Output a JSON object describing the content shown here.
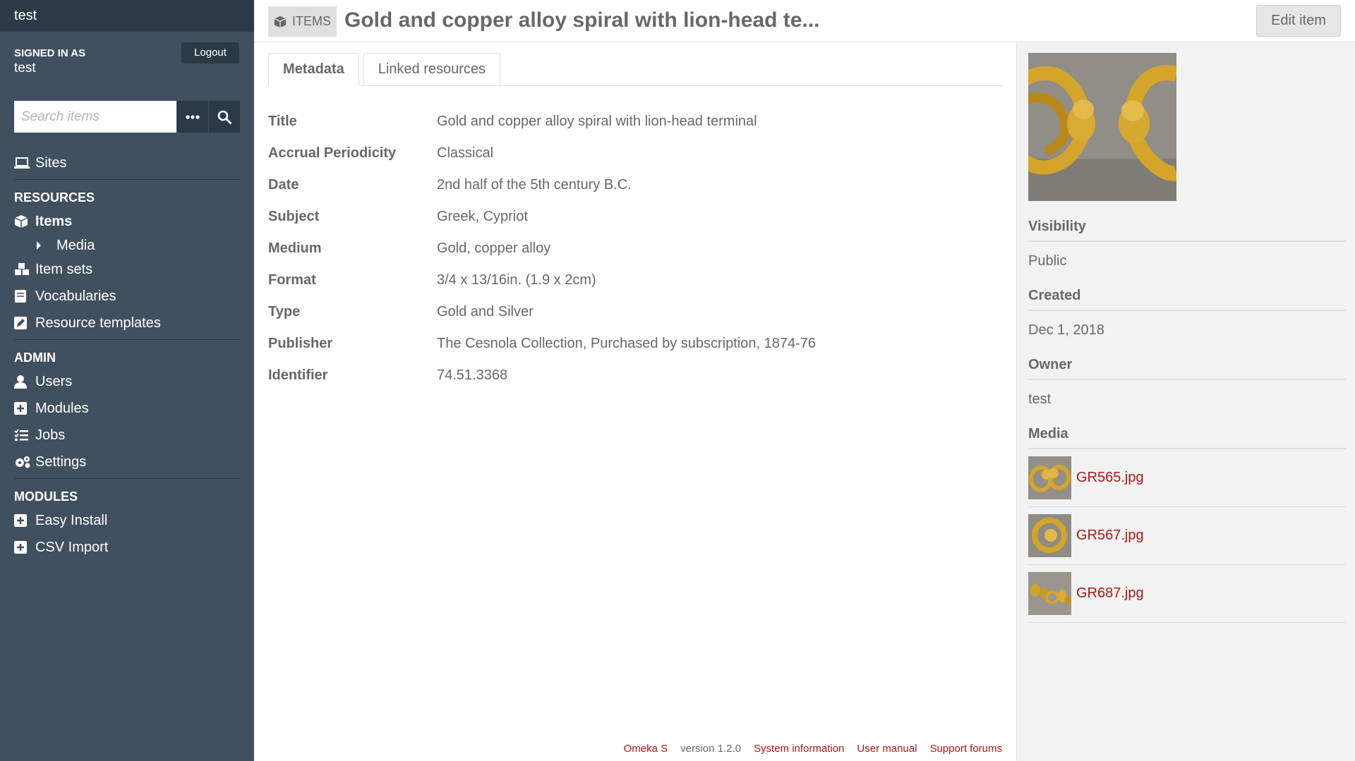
{
  "sidebar": {
    "site_title": "test",
    "signed_in_label": "SIGNED IN AS",
    "user_name": "test",
    "logout_label": "Logout",
    "search_placeholder": "Search items",
    "nav": {
      "sites": "Sites",
      "resources_heading": "RESOURCES",
      "items": "Items",
      "media": "Media",
      "item_sets": "Item sets",
      "vocabularies": "Vocabularies",
      "resource_templates": "Resource templates",
      "admin_heading": "ADMIN",
      "users": "Users",
      "modules": "Modules",
      "jobs": "Jobs",
      "settings": "Settings",
      "modules_heading": "MODULES",
      "easy_install": "Easy Install",
      "csv_import": "CSV Import"
    }
  },
  "header": {
    "breadcrumb": "ITEMS",
    "title": "Gold and copper alloy spiral with lion-head te...",
    "edit_label": "Edit item"
  },
  "tabs": [
    "Metadata",
    "Linked resources"
  ],
  "properties": [
    {
      "name": "Title",
      "value": "Gold and copper alloy spiral with lion-head terminal"
    },
    {
      "name": "Accrual Periodicity",
      "value": "Classical"
    },
    {
      "name": "Date",
      "value": "2nd half of the 5th century B.C."
    },
    {
      "name": "Subject",
      "value": "Greek, Cypriot"
    },
    {
      "name": "Medium",
      "value": "Gold, copper alloy"
    },
    {
      "name": "Format",
      "value": "3/4 x 13/16in. (1.9 x 2cm)"
    },
    {
      "name": "Type",
      "value": "Gold and Silver"
    },
    {
      "name": "Publisher",
      "value": "The Cesnola Collection, Purchased by subscription, 1874-76"
    },
    {
      "name": "Identifier",
      "value": "74.51.3368"
    }
  ],
  "panel": {
    "visibility_label": "Visibility",
    "visibility_value": "Public",
    "created_label": "Created",
    "created_value": "Dec 1, 2018",
    "owner_label": "Owner",
    "owner_value": "test",
    "media_label": "Media",
    "media": [
      "GR565.jpg",
      "GR567.jpg",
      "GR687.jpg"
    ]
  },
  "footer": {
    "omeka": "Omeka S",
    "version": "version 1.2.0",
    "system_info": "System information",
    "user_manual": "User manual",
    "support": "Support forums"
  },
  "colors": {
    "sidebar_bg": "#40505e",
    "sidebar_dark": "#2c3946",
    "link": "#a91919",
    "text": "#676767"
  }
}
